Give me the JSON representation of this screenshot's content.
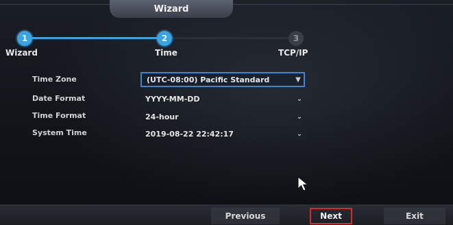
{
  "header": {
    "title": "Wizard"
  },
  "steps": [
    {
      "number": "1",
      "label": "Wizard",
      "state": "done"
    },
    {
      "number": "2",
      "label": "Time",
      "state": "active"
    },
    {
      "number": "3",
      "label": "TCP/IP",
      "state": "pending"
    }
  ],
  "form": {
    "rows": [
      {
        "label": "Time Zone",
        "value": "(UTC-08:00) Pacific Standard",
        "icon": "chevron-down-icon"
      },
      {
        "label": "Date Format",
        "value": "YYYY-MM-DD",
        "icon": "chevron-down-icon"
      },
      {
        "label": "Time Format",
        "value": "24-hour",
        "icon": "chevron-down-icon"
      },
      {
        "label": "System Time",
        "value": "2019-08-22 22:42:17",
        "icon": "chevron-down-icon"
      }
    ]
  },
  "footer": {
    "previous_label": "Previous",
    "next_label": "Next",
    "exit_label": "Exit"
  },
  "colors": {
    "accent": "#3aa3e0",
    "highlight_border": "#d42b2b",
    "selected_border": "#3a86d8"
  }
}
